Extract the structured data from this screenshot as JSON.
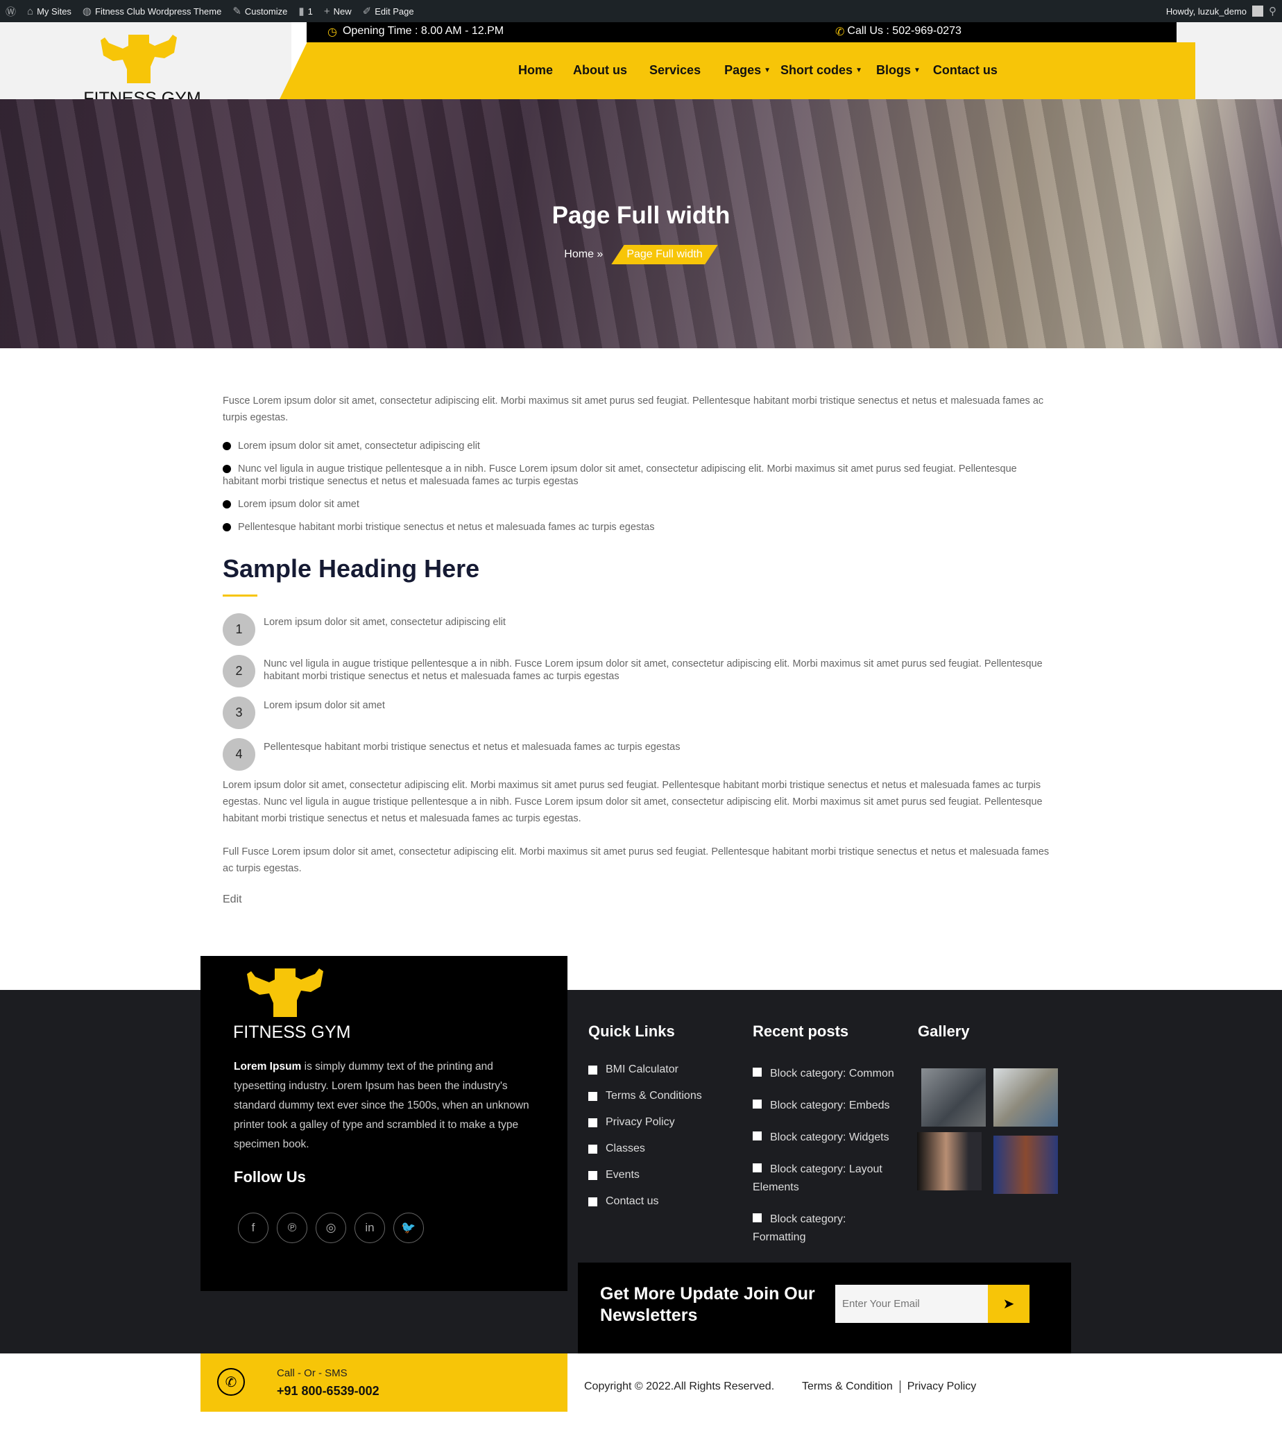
{
  "adminbar": {
    "my_sites": "My Sites",
    "site": "Fitness Club Wordpress Theme",
    "customize": "Customize",
    "comments": "1",
    "new": "New",
    "edit_page": "Edit Page",
    "howdy": "Howdy, luzuk_demo"
  },
  "header": {
    "logo_text": "FITNESS GYM",
    "opening": "Opening Time : 8.00 AM - 12.PM",
    "call": "Call Us : 502-969-0273",
    "nav": [
      "Home",
      "About us",
      "Services",
      "Pages",
      "Short codes",
      "Blogs",
      "Contact us"
    ]
  },
  "hero": {
    "title": "Page Full width",
    "crumb_home": "Home",
    "crumb_current": "Page Full width"
  },
  "content": {
    "intro": "Fusce Lorem ipsum dolor sit amet, consectetur adipiscing elit. Morbi maximus sit amet purus sed feugiat. Pellentesque habitant morbi tristique senectus et netus et malesuada fames ac turpis egestas.",
    "bullets": [
      "Lorem ipsum dolor sit amet, consectetur adipiscing elit",
      "Nunc vel ligula in augue tristique pellentesque a in nibh. Fusce Lorem ipsum dolor sit amet, consectetur adipiscing elit. Morbi maximus sit amet purus sed feugiat. Pellentesque habitant morbi tristique senectus et netus et malesuada fames ac turpis egestas",
      "Lorem ipsum dolor sit amet",
      "Pellentesque habitant morbi tristique senectus et netus et malesuada fames ac turpis egestas"
    ],
    "heading": "Sample Heading Here",
    "numbered": [
      {
        "n": "1",
        "text": "Lorem ipsum dolor sit amet, consectetur adipiscing elit"
      },
      {
        "n": "2",
        "text": "Nunc vel ligula in augue tristique pellentesque a in nibh. Fusce Lorem ipsum dolor sit amet, consectetur adipiscing elit. Morbi maximus sit amet purus sed feugiat. Pellentesque habitant morbi tristique senectus et netus et malesuada fames ac turpis egestas"
      },
      {
        "n": "3",
        "text": "Lorem ipsum dolor sit amet"
      },
      {
        "n": "4",
        "text": "Pellentesque habitant morbi tristique senectus et netus et malesuada fames ac turpis egestas"
      }
    ],
    "para2": "Lorem ipsum dolor sit amet, consectetur adipiscing elit. Morbi maximus sit amet purus sed feugiat. Pellentesque habitant morbi tristique senectus et netus et malesuada fames ac turpis egestas. Nunc vel ligula in augue tristique pellentesque a in nibh. Fusce Lorem ipsum dolor sit amet, consectetur adipiscing elit. Morbi maximus sit amet purus sed feugiat. Pellentesque habitant morbi tristique senectus et netus et malesuada fames ac turpis egestas.",
    "para3": "Full Fusce Lorem ipsum dolor sit amet, consectetur adipiscing elit. Morbi maximus sit amet purus sed feugiat. Pellentesque habitant morbi tristique senectus et netus et malesuada fames ac turpis egestas.",
    "edit": "Edit"
  },
  "footer": {
    "logo_text": "FITNESS GYM",
    "about_bold": "Lorem Ipsum",
    "about": " is simply dummy text of the printing and typesetting industry. Lorem Ipsum has been the industry's standard dummy text ever since the 1500s, when an unknown printer took a galley of type and scrambled it to make a type specimen book.",
    "follow": "Follow Us",
    "social": [
      "facebook-icon",
      "pinterest-icon",
      "instagram-icon",
      "linkedin-icon",
      "twitter-icon"
    ],
    "quick_title": "Quick Links",
    "quick": [
      "BMI Calculator",
      "Terms & Conditions",
      "Privacy Policy",
      "Classes",
      "Events",
      "Contact us"
    ],
    "recent_title": "Recent posts",
    "recent": [
      "Block category: Common",
      "Block category: Embeds",
      "Block category: Widgets",
      "Block category: Layout Elements",
      "Block category: Formatting"
    ],
    "gallery_title": "Gallery",
    "newsletter_title": "Get More Update Join Our Newsletters",
    "email_placeholder": "Enter Your Email",
    "call_label": "Call - Or - SMS",
    "call_number": "+91 800-6539-002",
    "copyright": "Copyright © 2022.All Rights Reserved.",
    "terms": "Terms & Condition",
    "privacy": "Privacy Policy"
  },
  "colors": {
    "accent": "#f7c508",
    "dark": "#1c1d21"
  }
}
